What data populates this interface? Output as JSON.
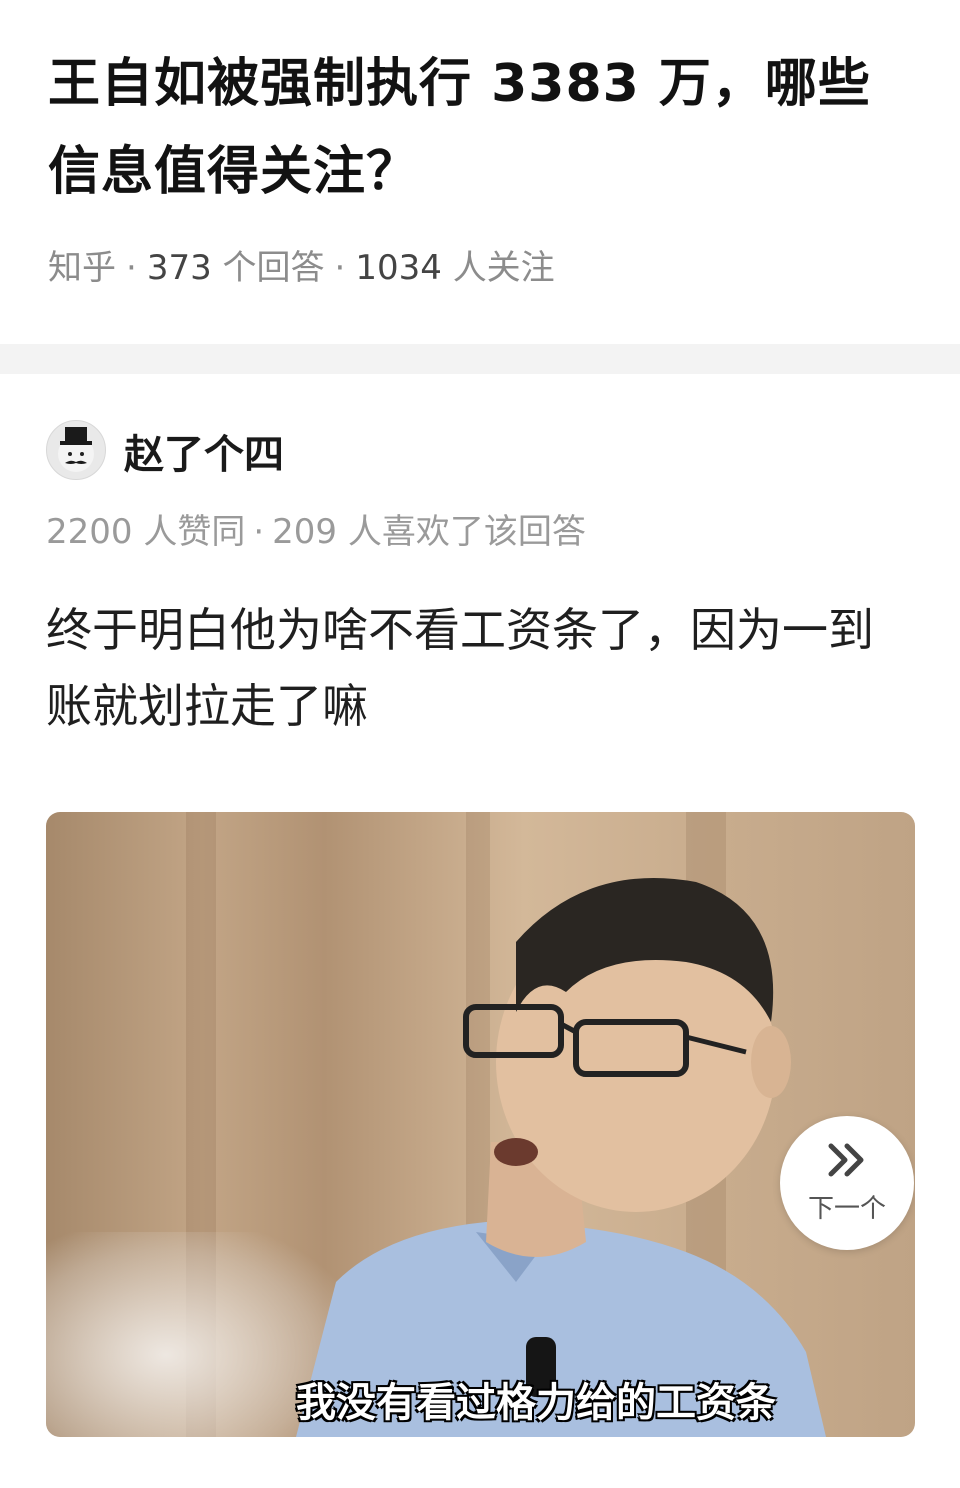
{
  "question": {
    "title": "王自如被强制执行 3383 万，哪些信息值得关注？",
    "source": "知乎",
    "answers_count": "373",
    "answers_label": "个回答",
    "followers_count": "1034",
    "followers_label": "人关注"
  },
  "answer": {
    "author_name": "赵了个四",
    "avatar_icon": "top-hat-mustache-avatar-icon",
    "upvotes": "2200",
    "upvotes_label": "人赞同",
    "likes": "209",
    "likes_label": "人喜欢了该回答",
    "text": "终于明白他为啥不看工资条了，因为一到账就划拉走了嘛",
    "image": {
      "subtitle": "我没有看过格力给的工资条"
    },
    "next_button_label": "下一个",
    "next_icon": "double-chevron-right-icon"
  },
  "colors": {
    "title": "#121212",
    "meta_gray": "#8c8c8c",
    "divider": "#f3f3f3"
  }
}
